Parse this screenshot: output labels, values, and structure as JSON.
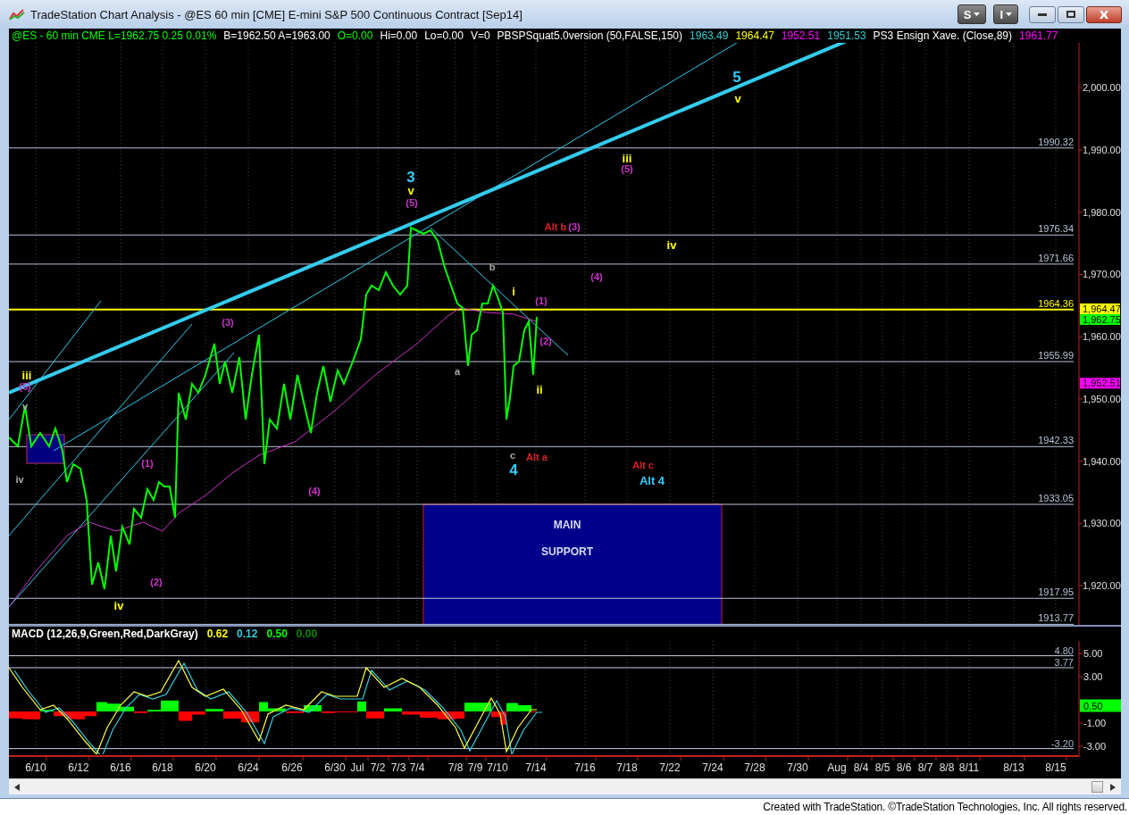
{
  "window": {
    "title": "TradeStation Chart Analysis - @ES 60 min [CME] E-mini S&P 500 Continuous Contract [Sep14]",
    "buttons": [
      {
        "label": "S"
      },
      {
        "label": "I"
      }
    ]
  },
  "price_panel": {
    "legend": [
      {
        "text": "@ES - 60 min  CME  L=1962.75  0.25  0.01%",
        "color": "#00ff00"
      },
      {
        "text": "B=1962.50  A=1963.00",
        "color": "#ffffff"
      },
      {
        "text": "O=0.00",
        "color": "#00ff00"
      },
      {
        "text": "Hi=0.00",
        "color": "#ffffff"
      },
      {
        "text": "Lo=0.00",
        "color": "#ffffff"
      },
      {
        "text": "V=0",
        "color": "#ffffff"
      },
      {
        "text": "PBSPSquat5.0version (50,FALSE,150)",
        "color": "#ffffff"
      },
      {
        "text": "1963.49",
        "color": "#33cccc"
      },
      {
        "text": "1964.47",
        "color": "#ffff00"
      },
      {
        "text": "1952.51",
        "color": "#ff00ff"
      },
      {
        "text": "1951.53",
        "color": "#33cccc"
      },
      {
        "text": "PS3 Ensign Xave. (Close,89)",
        "color": "#ffffff"
      },
      {
        "text": "1961.77",
        "color": "#ff00ff"
      }
    ],
    "levels": [
      {
        "label": "1990.32",
        "color": "#b8c4d8"
      },
      {
        "label": "1976.34",
        "color": "#b8c4d8"
      },
      {
        "label": "1971.66",
        "color": "#b8c4d8"
      },
      {
        "label": "1964.36",
        "color": "#ffff00"
      },
      {
        "label": "1955.99",
        "color": "#b8c4d8"
      },
      {
        "label": "1942.33",
        "color": "#b8c4d8"
      },
      {
        "label": "1933.05",
        "color": "#b8c4d8"
      },
      {
        "label": "1917.95",
        "color": "#b8c4d8"
      },
      {
        "label": "1913.77",
        "color": "#b8c4d8"
      }
    ],
    "zone": {
      "labels": [
        "MAIN",
        "SUPPORT"
      ]
    },
    "wave_labels": [
      {
        "text": "iii",
        "color": "#ffff00",
        "kind": "wave"
      },
      {
        "text": "(5)",
        "color": "#cc33cc",
        "kind": "minor"
      },
      {
        "text": "v",
        "color": "#aaaaaa",
        "kind": "minor"
      },
      {
        "text": "iv",
        "color": "#aaaaaa",
        "kind": "minor"
      },
      {
        "text": "(1)",
        "color": "#cc33cc",
        "kind": "minor"
      },
      {
        "text": "iv",
        "color": "#ffff00",
        "kind": "wave"
      },
      {
        "text": "(2)",
        "color": "#cc33cc",
        "kind": "minor"
      },
      {
        "text": "(3)",
        "color": "#cc33cc",
        "kind": "minor"
      },
      {
        "text": "(4)",
        "color": "#cc33cc",
        "kind": "minor"
      },
      {
        "text": "3",
        "color": "#33ccff",
        "kind": "major"
      },
      {
        "text": "v",
        "color": "#ffff00",
        "kind": "wave"
      },
      {
        "text": "(5)",
        "color": "#cc33cc",
        "kind": "minor"
      },
      {
        "text": "Alt b",
        "color": "#dd2222",
        "kind": "minor"
      },
      {
        "text": "(3)",
        "color": "#cc33cc",
        "kind": "minor"
      },
      {
        "text": "b",
        "color": "#aaaaaa",
        "kind": "minor"
      },
      {
        "text": "i",
        "color": "#ffff00",
        "kind": "wave"
      },
      {
        "text": "(1)",
        "color": "#cc33cc",
        "kind": "minor"
      },
      {
        "text": "(2)",
        "color": "#cc33cc",
        "kind": "minor"
      },
      {
        "text": "a",
        "color": "#aaaaaa",
        "kind": "minor"
      },
      {
        "text": "ii",
        "color": "#ffff00",
        "kind": "wave"
      },
      {
        "text": "c",
        "color": "#aaaaaa",
        "kind": "minor"
      },
      {
        "text": "4",
        "color": "#33ccff",
        "kind": "major"
      },
      {
        "text": "Alt a",
        "color": "#dd2222",
        "kind": "minor"
      },
      {
        "text": "(4)",
        "color": "#cc33cc",
        "kind": "minor"
      },
      {
        "text": "iii",
        "color": "#ffff00",
        "kind": "wave"
      },
      {
        "text": "(5)",
        "color": "#cc33cc",
        "kind": "minor"
      },
      {
        "text": "iv",
        "color": "#ffff00",
        "kind": "wave"
      },
      {
        "text": "5",
        "color": "#33ccff",
        "kind": "major"
      },
      {
        "text": "v",
        "color": "#ffff00",
        "kind": "wave"
      },
      {
        "text": "Alt c",
        "color": "#dd2222",
        "kind": "minor"
      },
      {
        "text": "Alt 4",
        "color": "#33ccff",
        "kind": "wave"
      }
    ],
    "axis_labels": [
      "2,000.00",
      "1,990.00",
      "1,980.00",
      "1,970.00",
      "1,960.00",
      "1,950.00",
      "1,940.00",
      "1,930.00",
      "1,920.00"
    ],
    "price_tags": [
      {
        "label": "1,964.47",
        "color": "#ffff00"
      },
      {
        "label": "1,962.75",
        "color": "#00ff00"
      },
      {
        "label": "1,952.51",
        "color": "#ff00ff"
      }
    ]
  },
  "macd_panel": {
    "legend": [
      {
        "text": "MACD (12,26,9,Green,Red,DarkGray)",
        "color": "#ffffff"
      },
      {
        "text": "0.62",
        "color": "#ffff00"
      },
      {
        "text": "0.12",
        "color": "#33ccdd"
      },
      {
        "text": "0.50",
        "color": "#00ff00"
      },
      {
        "text": "0.00",
        "color": "#008800"
      }
    ],
    "levels": [
      "4.80",
      "3.77",
      "-3.20"
    ],
    "axis_labels": [
      "5.00",
      "3.00",
      "-1.00",
      "-3.00"
    ],
    "value_tag": {
      "label": "0.50",
      "color": "#00ff00"
    }
  },
  "date_axis": {
    "labels": [
      "6/10",
      "6/12",
      "6/16",
      "6/18",
      "6/20",
      "6/24",
      "6/26",
      "6/30",
      "Jul",
      "7/2",
      "7/3",
      "7/4",
      "7/8",
      "7/9",
      "7/10",
      "7/14",
      "7/16",
      "7/18",
      "7/22",
      "7/24",
      "7/28",
      "7/30",
      "Aug",
      "8/4",
      "8/5",
      "8/6",
      "8/7",
      "8/8",
      "8/11",
      "8/13",
      "8/15"
    ]
  },
  "footer": "Created with TradeStation. ©TradeStation Technologies, Inc. All rights reserved."
}
